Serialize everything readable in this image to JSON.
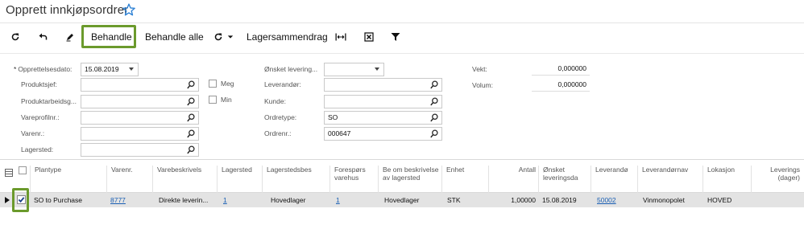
{
  "title": "Opprett innkjøpsordrer",
  "toolbar": {
    "process_label": "Behandle",
    "process_all_label": "Behandle alle",
    "inventory_summary_label": "Lagersammendrag",
    "icons": [
      "refresh-icon",
      "undo-icon",
      "edit-icon",
      "run-menu-icon",
      "fit-columns-icon",
      "export-excel-icon",
      "filter-icon"
    ]
  },
  "form": {
    "created_date_label": "Opprettelsesdato:",
    "created_date_value": "15.08.2019",
    "product_manager_label": "Produktsjef:",
    "product_workgroup_label": "Produktarbeidsg...",
    "item_profile_label": "Vareprofilnr.:",
    "item_no_label": "Varenr.:",
    "warehouse_label": "Lagersted:",
    "me_label": "Meg",
    "min_label": "Min",
    "requested_delivery_label": "Ønsket levering...",
    "vendor_label": "Leverandør:",
    "customer_label": "Kunde:",
    "order_type_label": "Ordretype:",
    "order_type_value": "SO",
    "order_no_label": "Ordrenr.:",
    "order_no_value": "000647",
    "weight_label": "Vekt:",
    "weight_value": "0,000000",
    "volume_label": "Volum:",
    "volume_value": "0,000000"
  },
  "grid": {
    "columns": [
      "Plantype",
      "Varenr.",
      "Varebeskrivels",
      "Lagersted",
      "Lagerstedsbes",
      "Forespørs varehus",
      "Be om beskrivelse av lagersted",
      "Enhet",
      "Antall",
      "Ønsket leveringsda",
      "Leverandø",
      "Leverandørnav",
      "Lokasjon",
      "Leverings (dager)"
    ],
    "row": {
      "plan_type": "SO to Purchase",
      "item_no": "8777",
      "item_desc": "Direkte leverin...",
      "warehouse": "1",
      "warehouse_desc": "Hovedlager",
      "request_warehouse": "1",
      "request_warehouse_desc": "Hovedlager",
      "uom": "STK",
      "qty": "1,00000",
      "requested_date": "15.08.2019",
      "vendor": "50002",
      "vendor_name": "Vinmonopolet",
      "location": "HOVED"
    }
  },
  "colors": {
    "highlight": "#6b9a2c",
    "link": "#1a5fb4",
    "selected_row": "#e3e3e3"
  }
}
